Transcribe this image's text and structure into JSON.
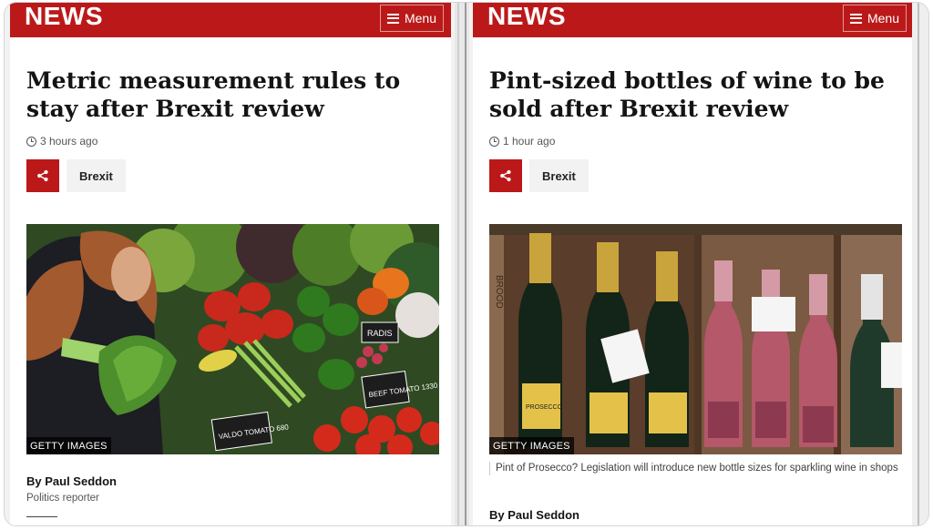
{
  "left": {
    "logo": "NEWS",
    "menu_label": "Menu",
    "headline": "Metric measurement rules to stay after Brexit review",
    "timestamp": "3 hours ago",
    "tag": "Brexit",
    "image_credit": "GETTY IMAGES",
    "price_tag_1": "RADIS",
    "price_tag_2": "BEEF TOMATO 1330",
    "price_tag_3": "VALDO TOMATO 680",
    "byline": "By Paul Seddon",
    "role": "Politics reporter"
  },
  "right": {
    "logo": "NEWS",
    "menu_label": "Menu",
    "headline": "Pint-sized bottles of wine to be sold after Brexit review",
    "timestamp": "1 hour ago",
    "tag": "Brexit",
    "image_credit": "GETTY IMAGES",
    "bottle_label": "PROSECCO",
    "crate_text": "BROOD",
    "caption": "Pint of Prosecco? Legislation will introduce new bottle sizes for sparkling wine in shops",
    "byline": "By Paul Seddon"
  },
  "colors": {
    "brand_red": "#bb1919",
    "tag_bg": "#f2f2f2"
  },
  "icons": {
    "menu": "hamburger-icon",
    "time": "clock-icon",
    "share": "share-icon"
  }
}
